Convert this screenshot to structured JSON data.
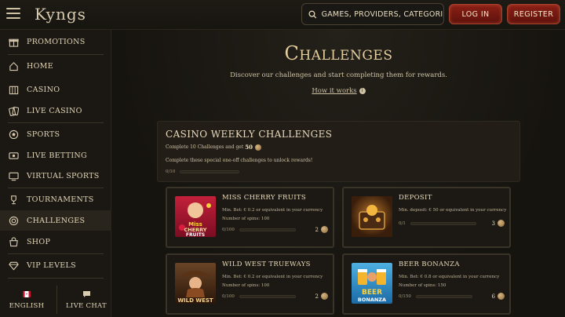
{
  "header": {
    "logo": "Kyngs",
    "search_placeholder": "GAMES, PROVIDERS, CATEGORIES",
    "login_label": "LOG IN",
    "register_label": "REGISTER"
  },
  "sidebar": {
    "items": [
      {
        "label": "Promotions",
        "icon": "gift-icon"
      },
      {
        "label": "Home",
        "icon": "home-icon"
      },
      {
        "label": "Casino",
        "icon": "casino-icon"
      },
      {
        "label": "Live Casino",
        "icon": "cards-icon"
      },
      {
        "label": "Sports",
        "icon": "soccer-ball-icon"
      },
      {
        "label": "Live Betting",
        "icon": "live-betting-icon"
      },
      {
        "label": "Virtual Sports",
        "icon": "virtual-sports-icon"
      },
      {
        "label": "Tournaments",
        "icon": "trophy-icon"
      },
      {
        "label": "Challenges",
        "icon": "challenges-icon"
      },
      {
        "label": "Shop",
        "icon": "shop-icon"
      },
      {
        "label": "VIP Levels",
        "icon": "diamond-icon"
      }
    ],
    "active_index": 8,
    "language_label": "English",
    "live_chat_label": "Live Chat"
  },
  "main": {
    "title": "Challenges",
    "subtitle": "Discover our challenges and start completing them for rewards.",
    "how_it_works": "How it works",
    "weekly": {
      "title": "CASINO WEEKLY CHALLENGES",
      "line1": "Complete 10 Challenges and get",
      "reward": "50",
      "line2": "Complete these special one-off challenges to unlock rewards!",
      "progress_text": "0/10",
      "progress": 0
    },
    "cards": [
      {
        "title": "MISS CHERRY FRUITS",
        "desc1": "Min. Bet: € 0.2 or equivalent in your currency",
        "desc2": "Number of spins: 100",
        "progress_text": "0/100",
        "progress": 0,
        "reward": "2",
        "thumb_text": "Miss CHERRY FRUITS"
      },
      {
        "title": "DEPOSIT",
        "desc1": "Min. deposit: € 50 or equivalent in your currency",
        "desc2": "",
        "progress_text": "0/1",
        "progress": 0,
        "reward": "3",
        "thumb_text": ""
      },
      {
        "title": "WILD WEST TRUEWAYS",
        "desc1": "Min. Bet: € 0.2 or equivalent in your currency",
        "desc2": "Number of spins: 100",
        "progress_text": "0/100",
        "progress": 0,
        "reward": "2",
        "thumb_text": "WILD WEST"
      },
      {
        "title": "BEER BONANZA",
        "desc1": "Min. Bet: € 0.8 or equivalent in your currency",
        "desc2": "Number of spins: 150",
        "progress_text": "0/150",
        "progress": 0,
        "reward": "6",
        "thumb_text": "BEER BONANZA"
      }
    ]
  },
  "colors": {
    "accent_gold": "#e6cf9e",
    "button_red": "#8a2016",
    "background": "#16140f"
  }
}
